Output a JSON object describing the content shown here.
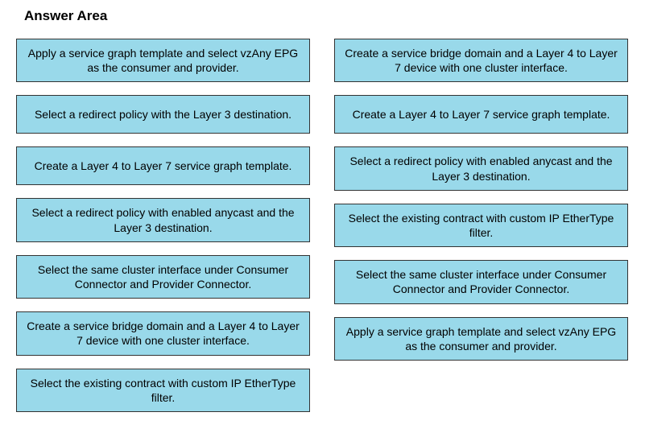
{
  "title": "Answer Area",
  "leftColumn": {
    "items": [
      "Apply a service graph template and select vzAny EPG as the consumer and provider.",
      "Select a redirect policy with the Layer 3 destination.",
      "Create a Layer 4 to Layer 7 service graph template.",
      "Select a redirect policy with enabled anycast and the Layer 3 destination.",
      "Select the same cluster interface under Consumer Connector and Provider Connector.",
      "Create a service bridge domain and a Layer 4 to Layer 7 device with one cluster interface.",
      "Select the existing contract with custom IP EtherType filter."
    ]
  },
  "rightColumn": {
    "items": [
      "Create a service bridge domain and a Layer 4 to Layer 7 device with one cluster interface.",
      "Create a Layer 4 to Layer 7 service graph template.",
      "Select a redirect policy with enabled anycast and the Layer 3 destination.",
      "Select the existing contract with custom IP EtherType filter.",
      "Select the same cluster interface under Consumer Connector and Provider Connector.",
      "Apply a service graph template and select vzAny EPG as the consumer and provider."
    ]
  }
}
